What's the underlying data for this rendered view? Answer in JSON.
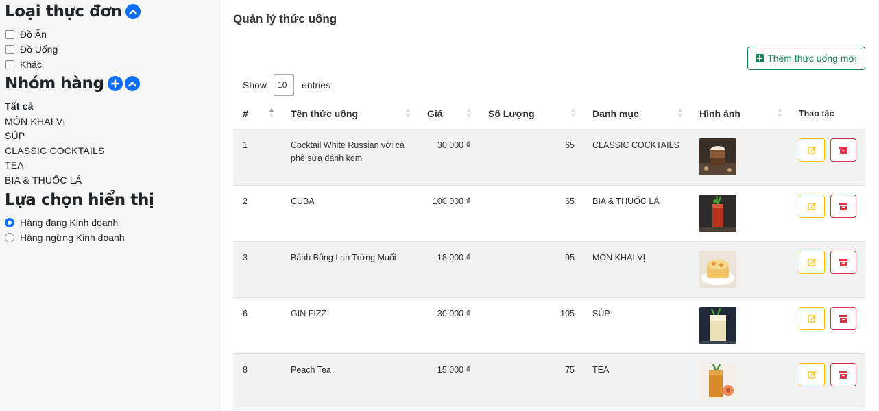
{
  "sidebar": {
    "menu_type_title": "Loại thực đơn",
    "menu_types": [
      {
        "label": "Đồ Ăn"
      },
      {
        "label": "Đồ Uống"
      },
      {
        "label": "Khác"
      }
    ],
    "group_title": "Nhóm hàng",
    "groups": [
      {
        "label": "Tất cả"
      },
      {
        "label": "MÓN KHAI VỊ"
      },
      {
        "label": "SÚP"
      },
      {
        "label": "CLASSIC COCKTAILS"
      },
      {
        "label": "TEA"
      },
      {
        "label": "BIA & THUỐC LÁ"
      }
    ],
    "display_title": "Lựa chọn hiển thị",
    "display_options": [
      {
        "label": "Hàng đang Kinh doanh",
        "selected": true
      },
      {
        "label": "Hàng ngừng Kinh doanh",
        "selected": false
      }
    ]
  },
  "main": {
    "title": "Quản lý thức uống",
    "add_button": "Thêm thức uống mới",
    "show_label": "Show",
    "show_value": "10",
    "entries_label": "entries",
    "columns": [
      "#",
      "Tên thức uống",
      "Giá",
      "Số Lượng",
      "Danh mục",
      "Hình ảnh",
      "Thao tác"
    ],
    "rows": [
      {
        "id": "1",
        "name": "Cocktail White Russian với cà phê sữa đánh kem",
        "price": "30.000 ₫",
        "qty": "65",
        "category": "CLASSIC COCKTAILS",
        "image_icon": "white-russian-photo"
      },
      {
        "id": "2",
        "name": "CUBA",
        "price": "100.000 ₫",
        "qty": "65",
        "category": "BIA & THUỐC LÁ",
        "image_icon": "cuba-drink-photo"
      },
      {
        "id": "3",
        "name": "Bánh Bông Lan Trứng Muối",
        "price": "18.000 ₫",
        "qty": "95",
        "category": "MÓN KHAI VỊ",
        "image_icon": "sponge-cake-photo"
      },
      {
        "id": "6",
        "name": "GIN FIZZ",
        "price": "30.000 ₫",
        "qty": "105",
        "category": "SÚP",
        "image_icon": "gin-fizz-photo"
      },
      {
        "id": "8",
        "name": "Peach Tea",
        "price": "15.000 ₫",
        "qty": "75",
        "category": "TEA",
        "image_icon": "peach-tea-photo"
      }
    ]
  },
  "colors": {
    "primary": "#0d6efd",
    "success": "#198754",
    "warning": "#ffc107",
    "danger": "#dc3545"
  }
}
